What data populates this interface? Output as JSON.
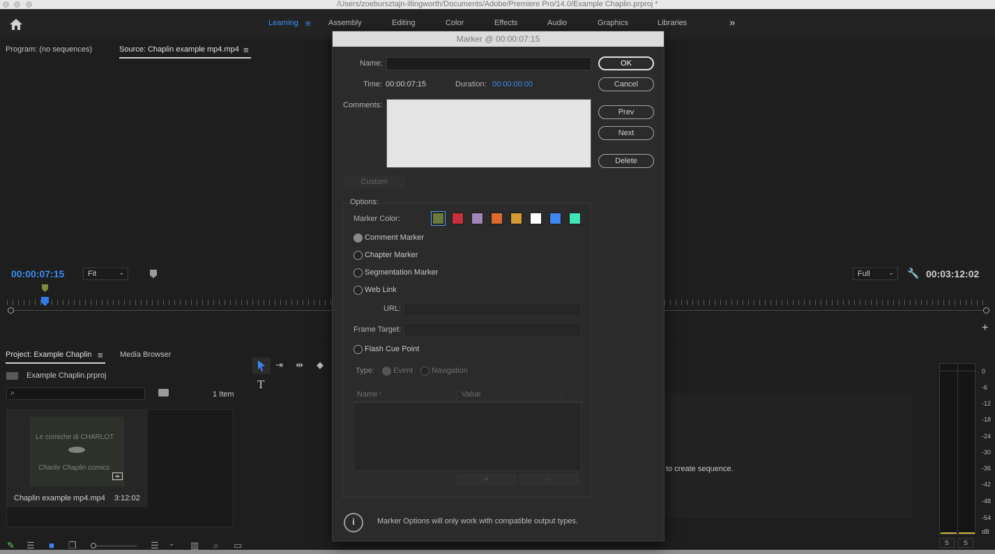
{
  "window": {
    "title": "/Users/zoebursztajn-illingworth/Documents/Adobe/Premiere Pro/14.0/Example Chaplin.prproj *"
  },
  "workspaces": {
    "items": [
      "Learning",
      "Assembly",
      "Editing",
      "Color",
      "Effects",
      "Audio",
      "Graphics",
      "Libraries"
    ],
    "active": "Learning",
    "overflow_icon": "double-chevron-right-icon"
  },
  "monitor": {
    "program_tab": "Program: (no sequences)",
    "source_tab": "Source: Chaplin example mp4.mp4",
    "current_time": "00:00:07:15",
    "zoom_select": "Fit",
    "resolution_select": "Full",
    "duration_time": "00:03:12:02"
  },
  "project": {
    "tab_label": "Project: Example Chaplin",
    "media_browser_tab": "Media Browser",
    "project_file": "Example Chaplin.prproj",
    "item_count": "1 Item",
    "clip": {
      "name": "Chaplin example mp4.mp4",
      "duration": "3:12:02",
      "thumb_line1": "Le comiche di CHARLOT",
      "thumb_line2": "Charlie Chaplin comics"
    }
  },
  "timeline": {
    "hint": "to create sequence."
  },
  "meter": {
    "scale": [
      "0",
      "-6",
      "-12",
      "-18",
      "-24",
      "-30",
      "-36",
      "-42",
      "-48",
      "-54",
      "dB"
    ],
    "solo": [
      "S",
      "S"
    ]
  },
  "dialog": {
    "title": "Marker @ 00:00:07:15",
    "name_label": "Name:",
    "name_value": "",
    "time_label": "Time:",
    "time_value": "00:00:07:15",
    "duration_label": "Duration:",
    "duration_value": "00:00:00:00",
    "comments_label": "Comments:",
    "custom_label": "Custom",
    "buttons": {
      "ok": "OK",
      "cancel": "Cancel",
      "prev": "Prev",
      "next": "Next",
      "delete": "Delete"
    },
    "options_label": "Options:",
    "marker_color_label": "Marker Color:",
    "colors": [
      "#6b7a3a",
      "#c8313c",
      "#a386b8",
      "#dd6a2f",
      "#d49a34",
      "#ffffff",
      "#3f86ee",
      "#3fe5b6"
    ],
    "marker_types": [
      "Comment Marker",
      "Chapter Marker",
      "Segmentation Marker",
      "Web Link"
    ],
    "selected_type": "Comment Marker",
    "url_label": "URL:",
    "frame_target_label": "Frame Target:",
    "flash_cue": "Flash Cue Point",
    "type_label": "Type:",
    "type_options": [
      "Event",
      "Navigation"
    ],
    "table_headers": [
      "Name",
      "Value"
    ],
    "add_label": "+",
    "remove_label": "-",
    "info_text": "Marker Options will only work with compatible output types."
  }
}
